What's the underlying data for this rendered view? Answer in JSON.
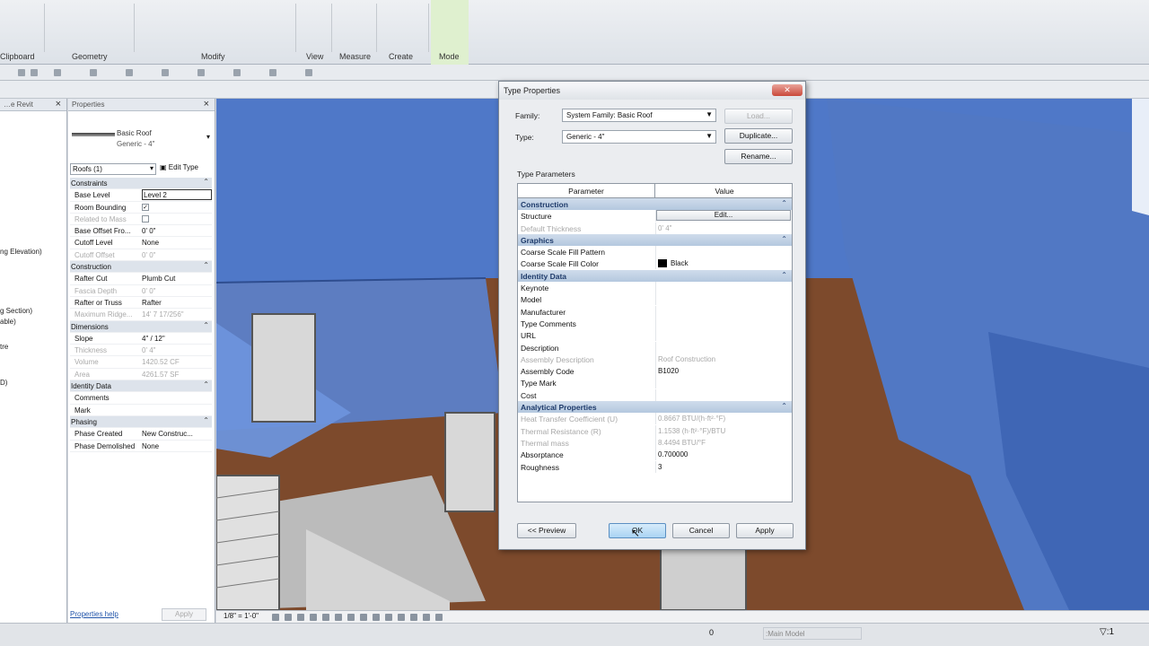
{
  "ribbon": {
    "panels": [
      "Clipboard",
      "Geometry",
      "Modify",
      "View",
      "Measure",
      "Create",
      "Mode"
    ]
  },
  "browser": {
    "title": "…e Revit",
    "items": [
      "ng Elevation)",
      "g Section)",
      "able)",
      "tre",
      "D)"
    ]
  },
  "properties": {
    "title": "Properties",
    "type_name": "Basic Roof",
    "type_sub": "Generic - 4\"",
    "instance_filter": "Roofs (1)",
    "edit_type": "Edit Type",
    "rows": [
      {
        "name": "Constraints",
        "cat": true
      },
      {
        "name": "Base Level",
        "value": "Level 2",
        "sel": true
      },
      {
        "name": "Room Bounding",
        "value": "✓",
        "check": true
      },
      {
        "name": "Related to Mass",
        "value": "",
        "dis": true,
        "check": true
      },
      {
        "name": "Base Offset Fro...",
        "value": "0' 0\""
      },
      {
        "name": "Cutoff Level",
        "value": "None"
      },
      {
        "name": "Cutoff Offset",
        "value": "0' 0\"",
        "dis": true
      },
      {
        "name": "Construction",
        "cat": true
      },
      {
        "name": "Rafter Cut",
        "value": "Plumb Cut"
      },
      {
        "name": "Fascia Depth",
        "value": "0' 0\"",
        "dis": true
      },
      {
        "name": "Rafter or Truss",
        "value": "Rafter"
      },
      {
        "name": "Maximum Ridge...",
        "value": "14' 7 17/256\"",
        "dis": true
      },
      {
        "name": "Dimensions",
        "cat": true
      },
      {
        "name": "Slope",
        "value": "4\" / 12\""
      },
      {
        "name": "Thickness",
        "value": "0' 4\"",
        "dis": true
      },
      {
        "name": "Volume",
        "value": "1420.52 CF",
        "dis": true
      },
      {
        "name": "Area",
        "value": "4261.57 SF",
        "dis": true
      },
      {
        "name": "Identity Data",
        "cat": true
      },
      {
        "name": "Comments",
        "value": ""
      },
      {
        "name": "Mark",
        "value": ""
      },
      {
        "name": "Phasing",
        "cat": true
      },
      {
        "name": "Phase Created",
        "value": "New Construc..."
      },
      {
        "name": "Phase Demolished",
        "value": "None"
      }
    ],
    "help_link": "Properties help",
    "apply": "Apply"
  },
  "viewbar": {
    "scale": "1/8\" = 1'-0\""
  },
  "status": {
    "selection": "0",
    "model": ":Main Model",
    "filter": "▽:1"
  },
  "dialog": {
    "title": "Type Properties",
    "close": "✕",
    "family_label": "Family:",
    "family_value": "System Family: Basic Roof",
    "type_label": "Type:",
    "type_value": "Generic - 4\"",
    "load_btn": "Load...",
    "duplicate_btn": "Duplicate...",
    "rename_btn": "Rename...",
    "type_params_label": "Type Parameters",
    "col_param": "Parameter",
    "col_value": "Value",
    "rows": [
      {
        "name": "Construction",
        "cat": true
      },
      {
        "name": "Structure",
        "value": "Edit...",
        "btn": true
      },
      {
        "name": "Default Thickness",
        "value": "0' 4\"",
        "dis": true
      },
      {
        "name": "Graphics",
        "cat": true
      },
      {
        "name": "Coarse Scale Fill Pattern",
        "value": ""
      },
      {
        "name": "Coarse Scale Fill Color",
        "value": "Black",
        "swatch": true
      },
      {
        "name": "Identity Data",
        "cat": true
      },
      {
        "name": "Keynote",
        "value": ""
      },
      {
        "name": "Model",
        "value": ""
      },
      {
        "name": "Manufacturer",
        "value": ""
      },
      {
        "name": "Type Comments",
        "value": ""
      },
      {
        "name": "URL",
        "value": ""
      },
      {
        "name": "Description",
        "value": ""
      },
      {
        "name": "Assembly Description",
        "value": "Roof Construction",
        "dis": true
      },
      {
        "name": "Assembly Code",
        "value": "B1020"
      },
      {
        "name": "Type Mark",
        "value": ""
      },
      {
        "name": "Cost",
        "value": ""
      },
      {
        "name": "Analytical Properties",
        "cat": true
      },
      {
        "name": "Heat Transfer Coefficient (U)",
        "value": "0.8667 BTU/(h·ft²·°F)",
        "dis": true
      },
      {
        "name": "Thermal Resistance (R)",
        "value": "1.1538 (h·ft²·°F)/BTU",
        "dis": true
      },
      {
        "name": "Thermal mass",
        "value": "8.4494 BTU/°F",
        "dis": true
      },
      {
        "name": "Absorptance",
        "value": "0.700000"
      },
      {
        "name": "Roughness",
        "value": "3"
      }
    ],
    "preview_btn": "<< Preview",
    "ok_btn": "OK",
    "cancel_btn": "Cancel",
    "apply_btn": "Apply"
  },
  "colors": {
    "roof_blue": "#4f78c8",
    "wall_brown": "#7d4a2c",
    "category_blue": "#b4c8df"
  }
}
